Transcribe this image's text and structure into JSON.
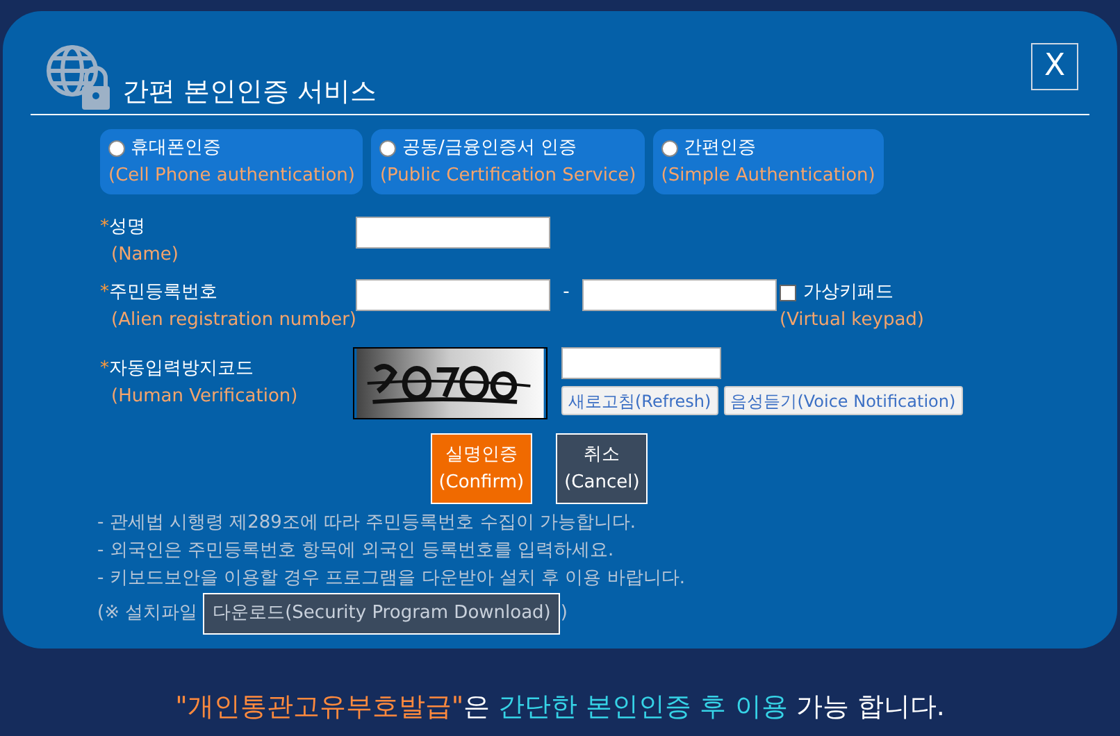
{
  "dialog": {
    "title": "간편 본인인증 서비스",
    "close_label": "X",
    "auth_methods": [
      {
        "label": "휴대폰인증",
        "english": "(Cell Phone authentication)",
        "selected": false
      },
      {
        "label": "공동/금융인증서 인증",
        "english": "(Public Certification Service)",
        "selected": false
      },
      {
        "label": "간편인증",
        "english": "(Simple Authentication)",
        "selected": false
      }
    ],
    "fields": [
      {
        "kind": "name",
        "marker": "*",
        "label": "성명",
        "english": "(Name)"
      },
      {
        "kind": "id_number",
        "marker": "*",
        "label": "주민등록번호",
        "english": "(Alien registration number)",
        "separator": "-",
        "keypad": {
          "label": "가상키패드",
          "english": "(Virtual keypad)",
          "checked": false
        }
      },
      {
        "kind": "captcha",
        "marker": "*",
        "label": "자동입력방지코드",
        "english": "(Human Verification)",
        "buttons": [
          "새로고침(Refresh)",
          "음성듣기(Voice Notification)"
        ]
      }
    ],
    "actions": [
      {
        "kind": "confirm",
        "label": "실명인증",
        "english": "(Confirm)"
      },
      {
        "kind": "cancel",
        "label": "취소",
        "english": "(Cancel)"
      }
    ],
    "notes": [
      "- 관세법 시행령 제289조에 따라 주민등록번호 수집이 가능합니다.",
      "- 외국인은 주민등록번호 항목에 외국인 등록번호를 입력하세요.",
      "- 키보드보안을 이용할 경우 프로그램을 다운받아 설치 후 이용 바랍니다."
    ],
    "install": {
      "prefix": "(※ 설치파일",
      "button": "다운로드(Security Program Download)",
      "suffix": ")"
    }
  },
  "footer": [
    {
      "kind": "highlight",
      "text": "\"개인통관고유부호발급\""
    },
    {
      "kind": "plain",
      "text": "은 "
    },
    {
      "kind": "accent",
      "text": "간단한 본인인증 후 이용"
    },
    {
      "kind": "plain",
      "text": " 가능 합니다."
    }
  ]
}
